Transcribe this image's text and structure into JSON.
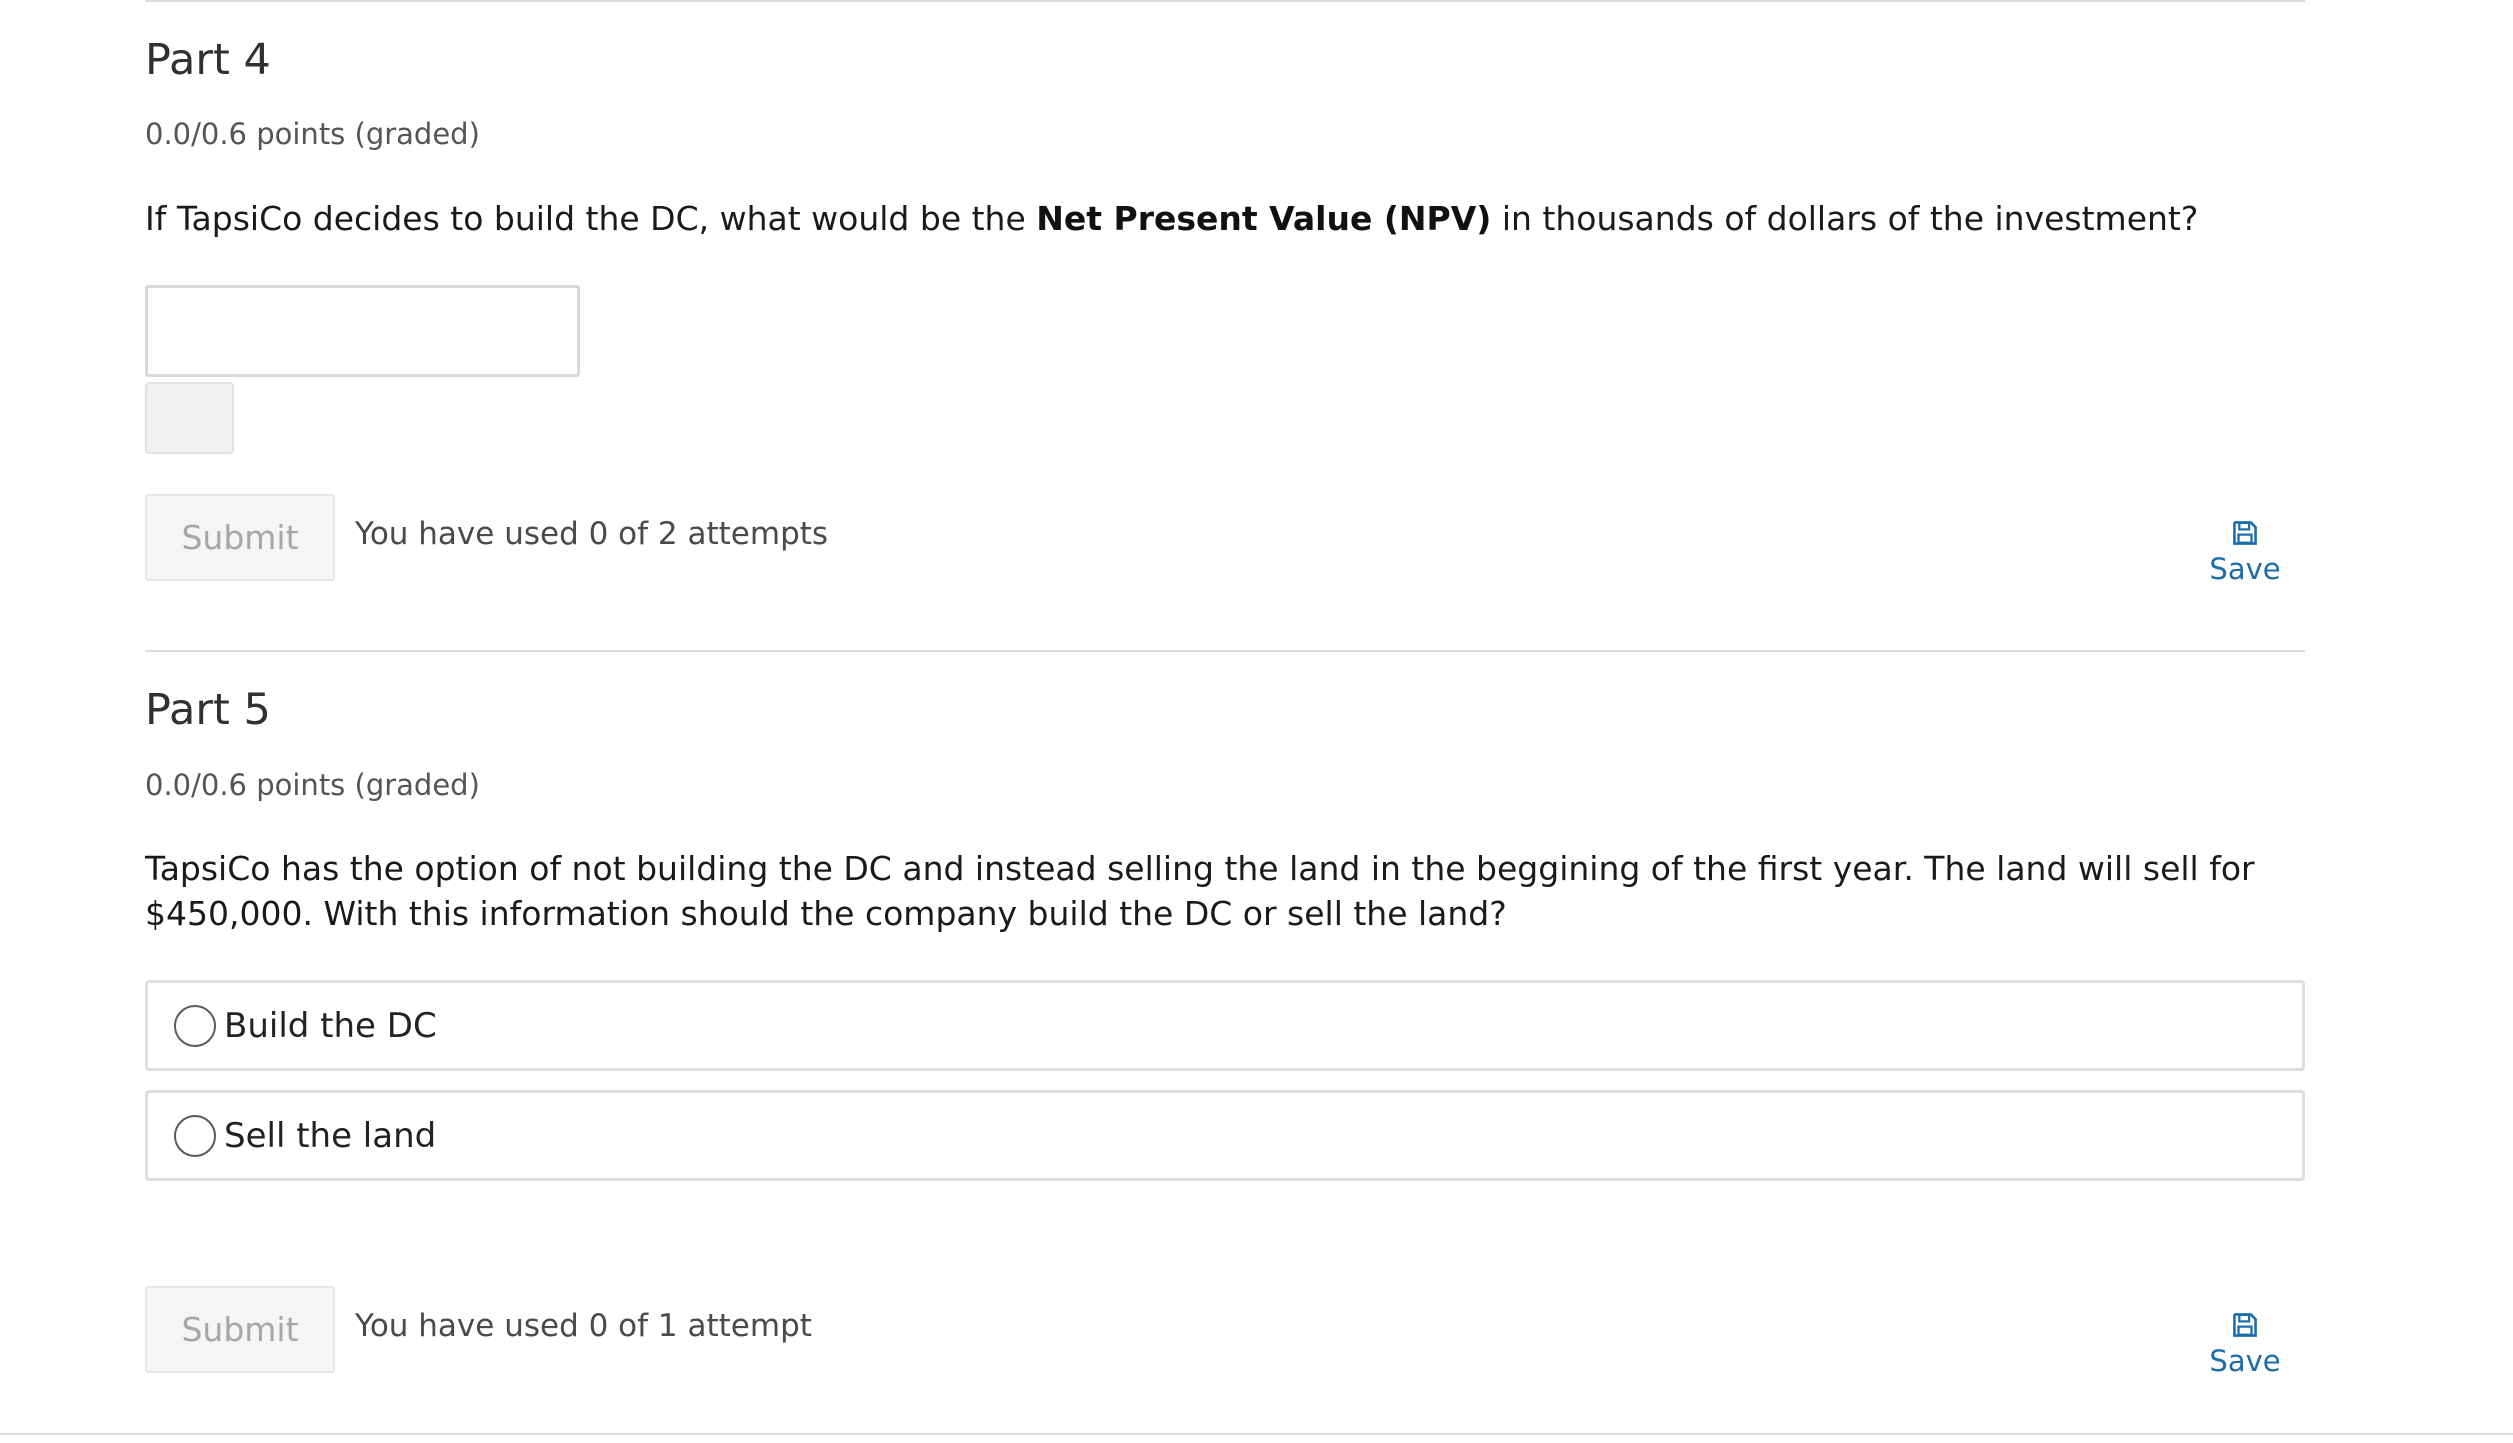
{
  "part4": {
    "title": "Part 4",
    "points": "0.0/0.6 points (graded)",
    "prompt_before": "If TapsiCo decides to build the DC, what would be the ",
    "prompt_bold": "Net Present Value (NPV)",
    "prompt_after": " in thousands of dollars of the investment?",
    "answer_value": "",
    "submit_label": "Submit",
    "attempts_text": "You have used 0 of 2 attempts",
    "save_label": "Save"
  },
  "part5": {
    "title": "Part 5",
    "points": "0.0/0.6 points (graded)",
    "prompt": "TapsiCo has the option of not building the DC and instead selling the land in the beggining of the first year. The land will sell for $450,000. With this information should the company build the DC or sell the land?",
    "choices": [
      {
        "label": "Build the DC",
        "selected": false
      },
      {
        "label": "Sell the land",
        "selected": false
      }
    ],
    "submit_label": "Submit",
    "attempts_text": "You have used 0 of 1 attempt",
    "save_label": "Save"
  },
  "colors": {
    "link": "#1b6ea8",
    "border": "#dcdcdc",
    "disabled_text": "#a6a6a6"
  },
  "icons": {
    "save": "floppy-disk-icon"
  }
}
